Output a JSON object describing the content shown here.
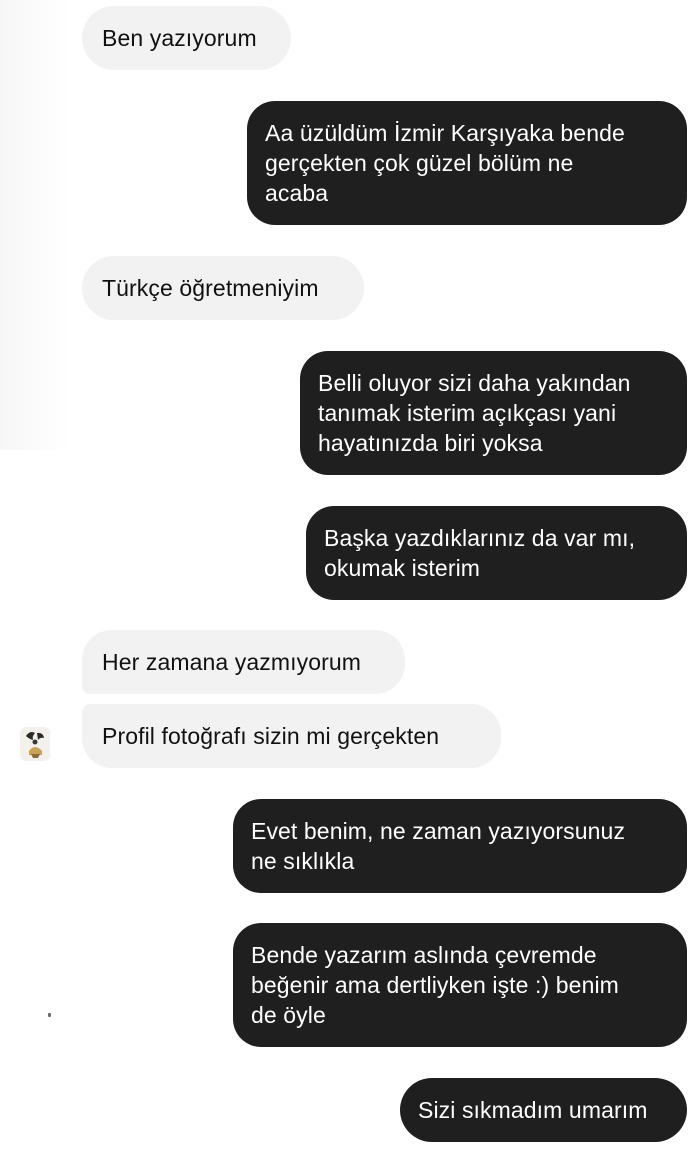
{
  "conversation": {
    "messages": [
      {
        "direction": "received",
        "text": "Ben yazıyorum"
      },
      {
        "direction": "sent",
        "text": "Aa üzüldüm İzmir Karşıyaka bende\ngerçekten çok güzel bölüm ne\nacaba"
      },
      {
        "direction": "received",
        "text": "Türkçe öğretmeniyim"
      },
      {
        "direction": "sent",
        "text": "Belli oluyor sizi daha yakından\ntanımak isterim açıkçası yani\nhayatınızda biri yoksa"
      },
      {
        "direction": "sent",
        "text": "Başka yazdıklarınız da var mı,\nokumak isterim"
      },
      {
        "direction": "received",
        "text": "Her zamana yazmıyorum"
      },
      {
        "direction": "received",
        "text": "Profil fotoğrafı sizin mi gerçekten"
      },
      {
        "direction": "sent",
        "text": "Evet benim, ne zaman yazıyorsunuz\nne sıklıkla"
      },
      {
        "direction": "sent",
        "text": "Bende yazarım aslında çevremde\nbeğenir ama dertliyken işte :) benim\nde öyle"
      },
      {
        "direction": "sent",
        "text": "Sizi sıkmadım umarım"
      }
    ]
  },
  "contact": {
    "avatar_icon": "profile-photo-thumbnail"
  },
  "colors": {
    "received_bubble": "#f2f2f2",
    "sent_bubble": "#1f1f1f",
    "sent_text": "#ffffff",
    "received_text": "#111111",
    "background": "#ffffff"
  }
}
